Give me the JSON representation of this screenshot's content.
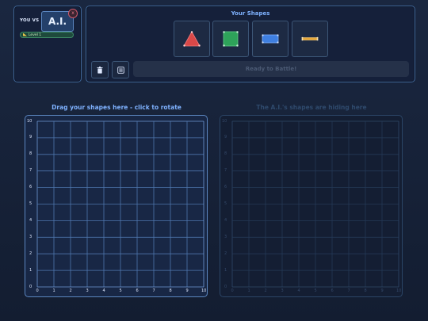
{
  "opponent": {
    "you_vs": "YOU VS",
    "name": "A.I.",
    "close": "x",
    "level": "Level 1",
    "icons": {
      "close": "close-icon",
      "level": "ruler-icon"
    }
  },
  "shapes_panel": {
    "title": "Your Shapes",
    "shapes": [
      {
        "name": "triangle",
        "color": "#d94848"
      },
      {
        "name": "square",
        "color": "#2ea35a"
      },
      {
        "name": "rectangle",
        "color": "#3f7fe0"
      },
      {
        "name": "line",
        "color": "#e8a93a"
      }
    ],
    "tools": [
      "trash-icon",
      "layout-icon"
    ],
    "ready_button": "Ready to Battle!"
  },
  "boards": {
    "player_title": "Drag your shapes here - click to rotate",
    "ai_title": "The A.I.'s shapes are hiding here",
    "grid_size": 10,
    "x_ticks": [
      "0",
      "1",
      "2",
      "3",
      "4",
      "5",
      "6",
      "7",
      "8",
      "9",
      "10"
    ],
    "y_ticks": [
      "10",
      "9",
      "8",
      "7",
      "6",
      "5",
      "4",
      "3",
      "2",
      "1",
      "0"
    ]
  },
  "colors": {
    "accent": "#7fb2ff",
    "panel_border": "#3f6596",
    "background": "#131d31"
  }
}
